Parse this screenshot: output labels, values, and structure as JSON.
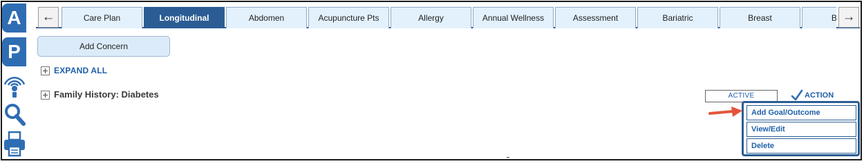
{
  "rail": {
    "tab_a": "A",
    "tab_p": "P",
    "icons": [
      "sensor-icon",
      "search-icon",
      "printer-icon"
    ]
  },
  "tabbar": {
    "prev_arrow": "←",
    "next_arrow": "→",
    "tabs": [
      {
        "label": "Care Plan",
        "active": false
      },
      {
        "label": "Longitudinal",
        "active": true
      },
      {
        "label": "Abdomen",
        "active": false
      },
      {
        "label": "Acupuncture Pts",
        "active": false
      },
      {
        "label": "Allergy",
        "active": false
      },
      {
        "label": "Annual Wellness",
        "active": false
      },
      {
        "label": "Assessment",
        "active": false
      },
      {
        "label": "Bariatric",
        "active": false
      },
      {
        "label": "Breast",
        "active": false
      },
      {
        "label": "Breas",
        "active": false
      }
    ]
  },
  "content": {
    "add_concern_label": "Add Concern",
    "expand_all_label": "EXPAND ALL",
    "concern": {
      "title": "Family History: Diabetes",
      "status": "ACTIVE",
      "action_label": "ACTION"
    },
    "action_menu": [
      "Add Goal/Outcome",
      "View/Edit",
      "Delete"
    ]
  },
  "colors": {
    "primary": "#2b5d94",
    "rail_blue": "#2f6db3",
    "tab_bg": "#e3f1fd",
    "link_blue": "#1f5fa8",
    "arrow_red": "#e4553b"
  }
}
